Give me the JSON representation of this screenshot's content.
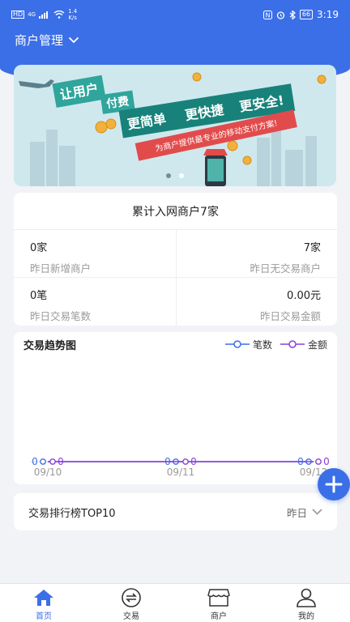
{
  "status_bar": {
    "network": "HD",
    "signal": "4G",
    "net_speed_value": "1.4",
    "net_speed_unit": "K/s",
    "battery": "66",
    "time": "3:19"
  },
  "header": {
    "title": "商户管理"
  },
  "banner": {
    "sign_text_1": "让用户",
    "sign_text_2": "付费",
    "slogan_1": "更简单",
    "slogan_2": "更快捷",
    "slogan_3": "更安全!",
    "ribbon": "为商户提供最专业的移动支付方案!",
    "active_slide": 1,
    "slide_count": 2
  },
  "summary": {
    "title": "累计入网商户7家",
    "stats": [
      {
        "value": "0家",
        "label": "昨日新增商户"
      },
      {
        "value": "7家",
        "label": "昨日无交易商户"
      },
      {
        "value": "0笔",
        "label": "昨日交易笔数"
      },
      {
        "value": "0.00元",
        "label": "昨日交易金额"
      }
    ]
  },
  "trend": {
    "title": "交易趋势图",
    "legend_count": "笔数",
    "legend_amount": "金额",
    "colors": {
      "count": "#3b6fe8",
      "amount": "#8a3fd8"
    }
  },
  "chart_data": {
    "type": "line",
    "title": "交易趋势图",
    "categories": [
      "09/10",
      "09/11",
      "09/12"
    ],
    "series": [
      {
        "name": "笔数",
        "values": [
          0,
          0,
          0
        ],
        "color": "#3b6fe8"
      },
      {
        "name": "金额",
        "values": [
          0,
          0,
          0
        ],
        "color": "#8a3fd8"
      }
    ],
    "legend": "top-right",
    "grid": false
  },
  "ranking": {
    "title": "交易排行榜TOP10",
    "period": "昨日"
  },
  "tabs": [
    {
      "label": "首页",
      "icon": "home-icon",
      "active": true
    },
    {
      "label": "交易",
      "icon": "exchange-icon",
      "active": false
    },
    {
      "label": "商户",
      "icon": "store-icon",
      "active": false
    },
    {
      "label": "我的",
      "icon": "user-icon",
      "active": false
    }
  ]
}
